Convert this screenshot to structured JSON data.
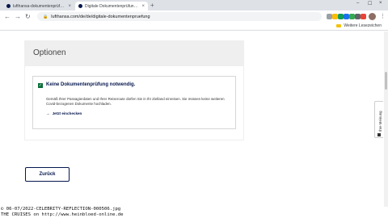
{
  "browser": {
    "tabs": [
      {
        "label": "lufthansa-dokumentenprüfung",
        "close": "×",
        "favicon_color": "#05164d"
      },
      {
        "label": "Digitale Dokumentenprüfung | L",
        "close": "×",
        "favicon_color": "#05164d"
      }
    ],
    "new_tab": "+",
    "window_controls": {
      "minimize": "–",
      "maximize": "☐",
      "close": "×"
    },
    "nav": {
      "back": "←",
      "forward": "→",
      "reload": "↻"
    },
    "address": "lufthansa.com/de/de/digitale-dokumentenpruefung",
    "extensions": [
      "#9aa0a6",
      "#fbbc04",
      "#0f9d58",
      "#1a73e8",
      "#34a853",
      "#5f6368",
      "#ea4335",
      "#5f6368"
    ],
    "bookmarks_other": "Weitere Lesezeichen"
  },
  "page": {
    "options_title": "Optionen",
    "result": {
      "heading": "Keine Dokumentenprüfung notwendig.",
      "text": "Gemäß Ihrer Passagierdaten und Ihrer Reiseroute dürfen Sie in Ihr Zielland einreisen. Sie müssen keine weiteren Covid-bezogenen Dokumente hochladen.",
      "link": "Jetzt einchecken",
      "check": "✓"
    },
    "back_button": "Zurück",
    "feedback": "Ihre Meinung"
  },
  "watermark": {
    "line1": "© 06-07/2022-CELEBRITY-REFLECTION-000506.jpg",
    "line2": "THE CRUISES on http://www.heinbloed-online.de"
  },
  "colors": {
    "brand_blue": "#05164d",
    "check_green": "#0b6e3a",
    "header_grey": "#efefef"
  }
}
